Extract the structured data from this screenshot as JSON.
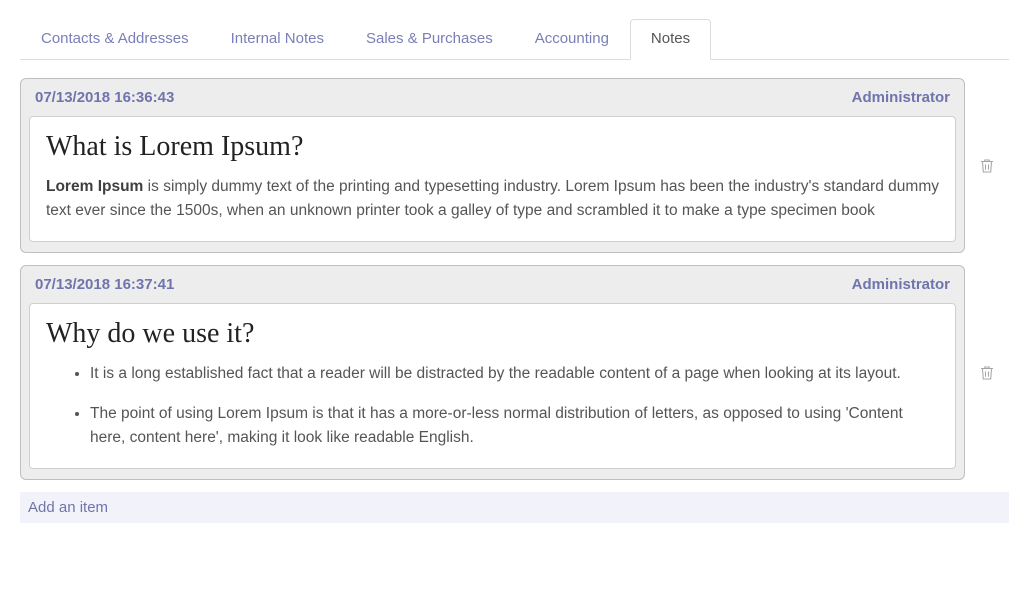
{
  "tabs": {
    "items": [
      {
        "label": "Contacts & Addresses",
        "active": false
      },
      {
        "label": "Internal Notes",
        "active": false
      },
      {
        "label": "Sales & Purchases",
        "active": false
      },
      {
        "label": "Accounting",
        "active": false
      },
      {
        "label": "Notes",
        "active": true
      }
    ]
  },
  "notes": [
    {
      "timestamp": "07/13/2018 16:36:43",
      "author": "Administrator",
      "title": "What is Lorem Ipsum?",
      "kind": "paragraph",
      "lead": "Lorem Ipsum",
      "body": " is simply dummy text of the printing and typesetting industry. Lorem Ipsum has been the industry's standard dummy text ever since the 1500s, when an unknown printer took a galley of type and scrambled it to make a type specimen book"
    },
    {
      "timestamp": "07/13/2018 16:37:41",
      "author": "Administrator",
      "title": "Why do we use it?",
      "kind": "list",
      "items": [
        "It is a long established fact that a reader will be distracted by the readable content of a page when looking at its layout.",
        "The point of using Lorem Ipsum is that it has a more-or-less normal distribution of letters, as opposed to using 'Content here, content here', making it look like readable English."
      ]
    }
  ],
  "footer": {
    "add_item": "Add an item"
  }
}
